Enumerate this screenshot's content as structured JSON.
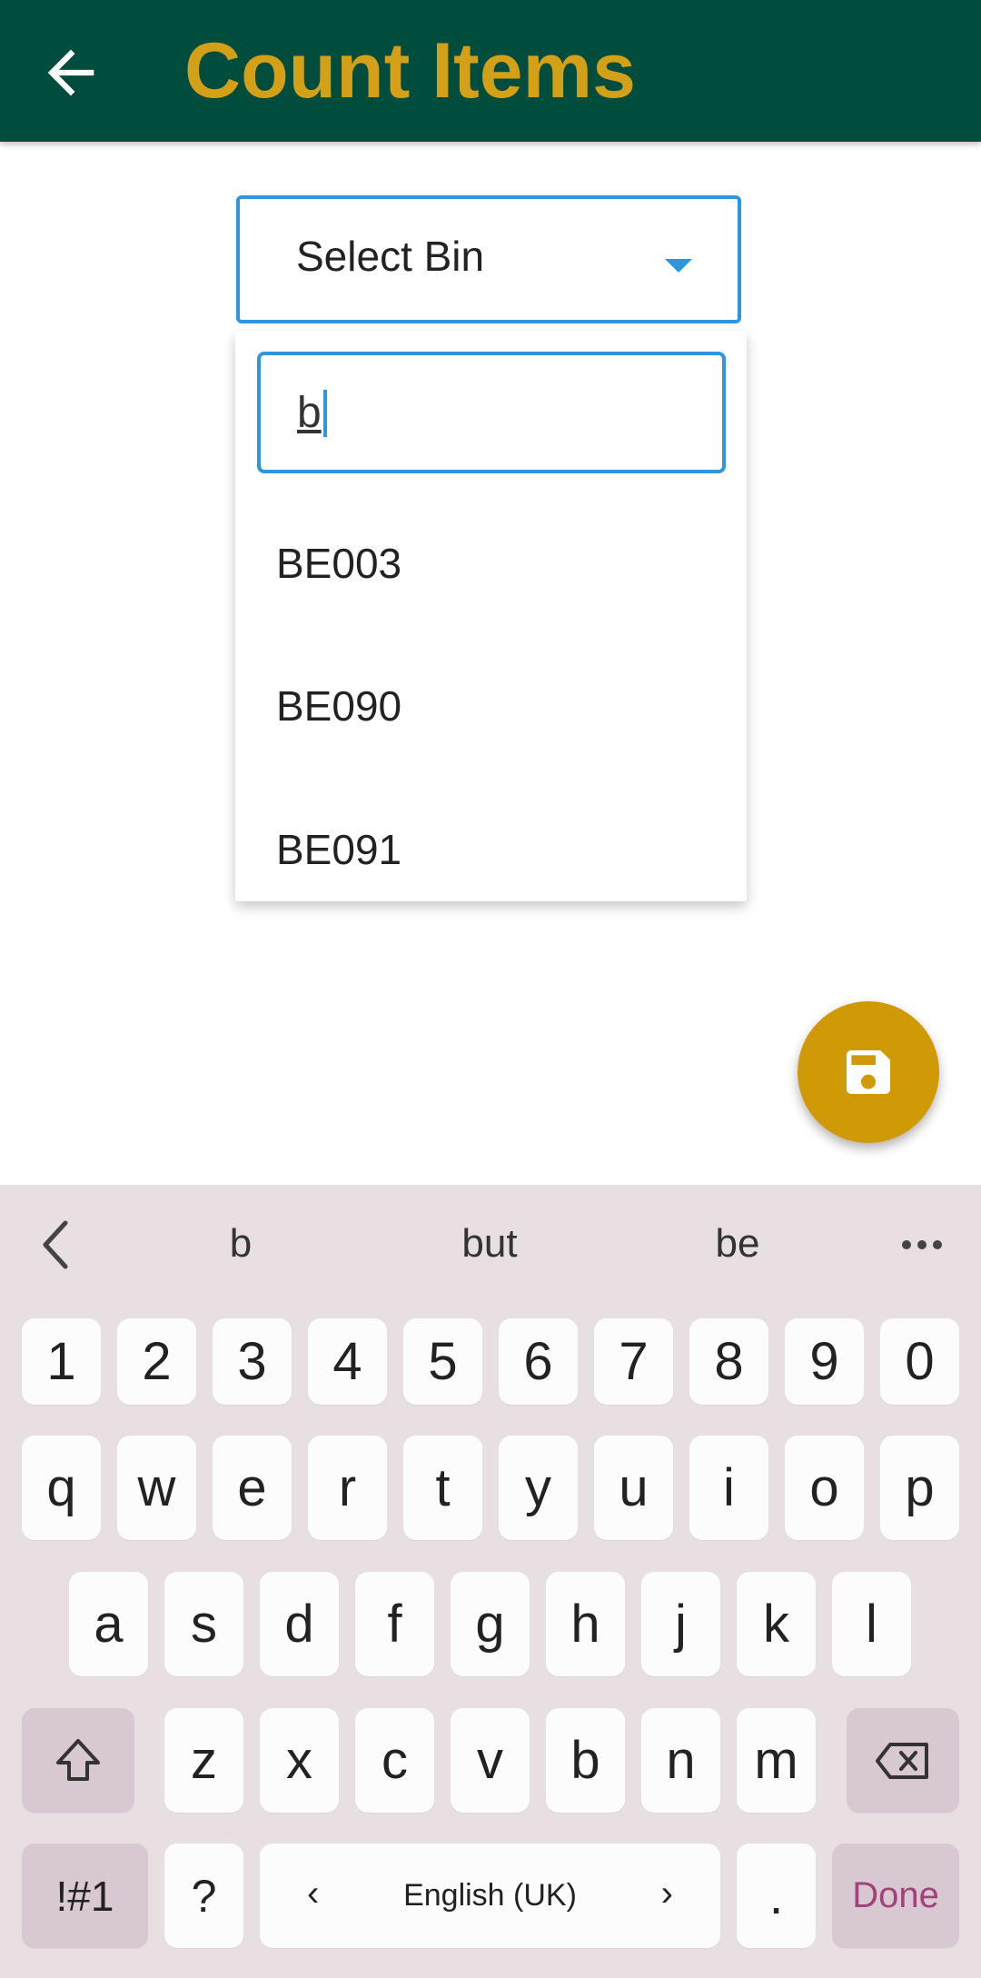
{
  "appbar": {
    "title": "Count Items",
    "back_icon": "arrow-left-icon",
    "bg_color": "#004d3e",
    "title_color": "#d4a017"
  },
  "bin_select": {
    "label": "Select Bin",
    "search_value": "b",
    "options": [
      "BE003",
      "BE090",
      "BE091"
    ]
  },
  "fab": {
    "icon": "save-icon",
    "color": "#d09a07"
  },
  "keyboard": {
    "suggestions": [
      "b",
      "but",
      "be"
    ],
    "number_row": [
      "1",
      "2",
      "3",
      "4",
      "5",
      "6",
      "7",
      "8",
      "9",
      "0"
    ],
    "row1": [
      "q",
      "w",
      "e",
      "r",
      "t",
      "y",
      "u",
      "i",
      "o",
      "p"
    ],
    "row2": [
      "a",
      "s",
      "d",
      "f",
      "g",
      "h",
      "j",
      "k",
      "l"
    ],
    "row3": [
      "z",
      "x",
      "c",
      "v",
      "b",
      "n",
      "m"
    ],
    "symbols_label": "!#1",
    "question_label": "?",
    "language_label": "English (UK)",
    "period_label": ".",
    "done_label": "Done"
  }
}
